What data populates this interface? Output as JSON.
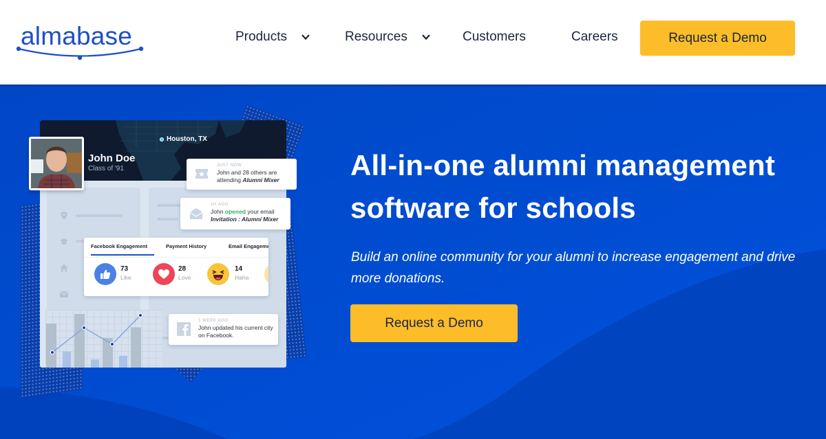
{
  "header": {
    "logo_text": "almabase",
    "nav": [
      {
        "label": "Products",
        "has_dropdown": true
      },
      {
        "label": "Resources",
        "has_dropdown": true
      },
      {
        "label": "Customers",
        "has_dropdown": false
      },
      {
        "label": "Careers",
        "has_dropdown": false
      }
    ],
    "cta_label": "Request a Demo"
  },
  "hero": {
    "headline": "All-in-one alumni management software for schools",
    "subtext": "Build an online community for your alumni to increase engagement and drive more donations.",
    "cta_label": "Request a Demo"
  },
  "illustration": {
    "location": "Houston, TX",
    "profile": {
      "name": "John Doe",
      "class": "Class of '91"
    },
    "notifications": [
      {
        "time": "JUST NOW",
        "text_pre": "John and 28 others are attending ",
        "text_em": "Alumni Mixer",
        "icon": "ticket-star-icon"
      },
      {
        "time": "1H AGO",
        "text_pre": "John ",
        "text_highlight": "opened",
        "text_mid": " your email",
        "text_em": "Invitation : Alumni Mixer",
        "icon": "envelope-open-icon"
      },
      {
        "time": "1 WEEK AGO",
        "text": "John updated his current city on Facebook.",
        "icon": "facebook-icon"
      }
    ],
    "engagement": {
      "tabs": [
        "Facebook Engagement",
        "Payment History",
        "Email Engagement"
      ],
      "active_tab": 0,
      "reactions": [
        {
          "name": "Like",
          "count": "73",
          "color": "#4b80e6"
        },
        {
          "name": "Love",
          "count": "28",
          "color": "#ef4558"
        },
        {
          "name": "Haha",
          "count": "14",
          "color": "#f8c43a"
        }
      ]
    },
    "mini_chart": {
      "bars": [
        0.82,
        1.0,
        0.55,
        0.75
      ],
      "small_bars": [
        0.3,
        0.15,
        0.22
      ],
      "line": [
        0.55,
        0.85,
        0.65,
        1.0
      ]
    }
  },
  "colors": {
    "brand": "#1f4fc4",
    "hero_bg": "#0048c8",
    "cta": "#fdbd28",
    "text_dark": "#1a2440"
  }
}
